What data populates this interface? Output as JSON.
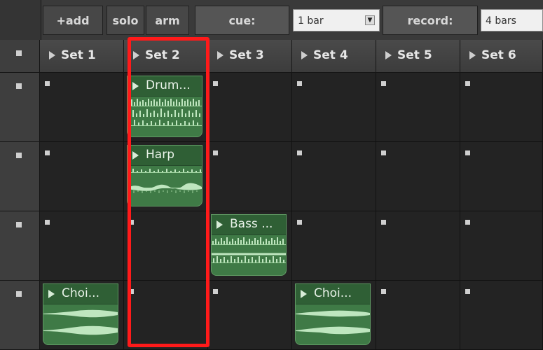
{
  "toolbar": {
    "add_label": "+add",
    "solo_label": "solo",
    "arm_label": "arm",
    "cue_label": "cue:",
    "cue_value": "1 bar",
    "record_label": "record:",
    "record_value": "4 bars"
  },
  "sets": [
    "Set 1",
    "Set 2",
    "Set 3",
    "Set 4",
    "Set 5",
    "Set 6"
  ],
  "clips": {
    "drum": "Drum...",
    "harp": "Harp",
    "bass": "Bass ...",
    "choir1": "Choi...",
    "choir2": "Choi..."
  },
  "colors": {
    "highlight": "#ff1a1a",
    "clip_green": "#3f7a46"
  }
}
